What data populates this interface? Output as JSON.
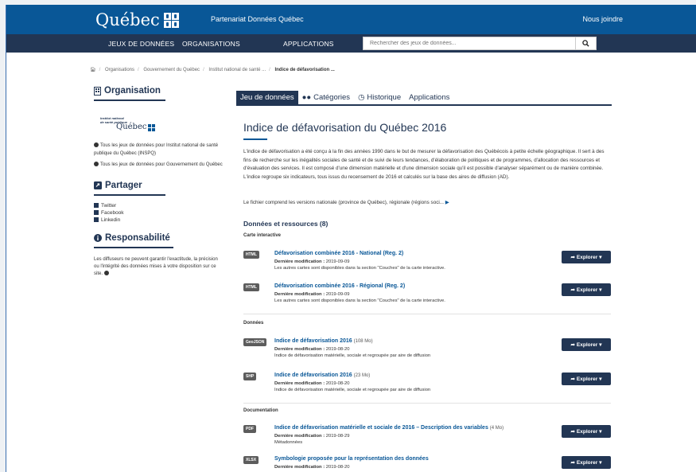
{
  "header": {
    "logo_text": "Québec",
    "site_title": "Partenariat Données Québec",
    "contact": "Nous joindre"
  },
  "nav": {
    "items": [
      "JEUX DE DONNÉES",
      "ORGANISATIONS",
      "APPLICATIONS"
    ],
    "search_placeholder": "Rechercher des jeux de données..."
  },
  "breadcrumb": {
    "items": [
      "Organisations",
      "Gouvernement du Québec",
      "Institut national de santé ...",
      "Indice de défavorisation ..."
    ]
  },
  "sidebar": {
    "org_heading": "Organisation",
    "org_logo_line1": "Institut national",
    "org_logo_line2": "de santé publique",
    "org_logo_line3": "Québec",
    "link1": "Tous les jeux de données pour Institut national de santé publique du Québec (INSPQ)",
    "link2": "Tous les jeux de données pour Gouvernement du Québec",
    "share_heading": "Partager",
    "share": [
      "Twitter",
      "Facebook",
      "Linkedin"
    ],
    "resp_heading": "Responsabilité",
    "resp_text": "Les diffuseurs ne peuvent garantir l'exactitude, la précision ou l'intégrité des données mises à votre disposition sur ce site."
  },
  "tabs": [
    "Jeu de données",
    "Catégories",
    "Historique",
    "Applications"
  ],
  "dataset": {
    "title": "Indice de défavorisation du Québec 2016",
    "description": "L'indice de défavorisation a été conçu à la fin des années 1990 dans le but de mesurer la défavorisation des Québécois à petite échelle géographique. Il sert à des fins de recherche sur les inégalités sociales de santé et de suivi de leurs tendances, d'élaboration de politiques et de programmes, d'allocation des ressources et d'évaluation des services. Il est composé d'une dimension matérielle et d'une dimension sociale qu'il est possible d'analyser séparément ou de manière combinée. L'indice regroupe six indicateurs, tous issus du recensement de 2016 et calculés sur la base des aires de diffusion (AD).",
    "description2": "Le fichier comprend les versions nationale (province de Québec), régionale (régions soci...",
    "resources_heading": "Données et ressources (8)"
  },
  "groups": {
    "g1": "Carte interactive",
    "g2": "Données",
    "g3": "Documentation"
  },
  "modified_label": "Dernière modification :",
  "explore_label": "Explorer",
  "resources": [
    {
      "format": "HTML",
      "name": "Défavorisation combinée 2016 - National (Reg. 2)",
      "size": "",
      "date": "2019-09-09",
      "note": "Les autres cartes sont disponibles dans la section \"Couches\" de la carte interactive."
    },
    {
      "format": "HTML",
      "name": "Défavorisation combinée 2016 - Régional (Reg. 2)",
      "size": "",
      "date": "2019-09-09",
      "note": "Les autres cartes sont disponibles dans la section \"Couches\" de la carte interactive."
    },
    {
      "format": "GeoJSON",
      "name": "Indice de défavorisation 2016",
      "size": "(108 Mo)",
      "date": "2019-08-20",
      "note": "Indice de défavorisation matérielle, sociale et regroupée par aire de diffusion"
    },
    {
      "format": "SHP",
      "name": "Indice de défavorisation 2016",
      "size": "(23 Mo)",
      "date": "2019-08-20",
      "note": "Indice de défavorisation matérielle, sociale et regroupée par aire de diffusion"
    },
    {
      "format": "PDF",
      "name": "Indice de défavorisation matérielle et sociale de 2016 – Description des variables",
      "size": "(4 Mo)",
      "date": "2019-08-29",
      "note": "Métadonnées"
    },
    {
      "format": "XLSX",
      "name": "Symbologie proposée pour la représentation des données",
      "size": "",
      "date": "2019-08-20",
      "note": ""
    }
  ]
}
